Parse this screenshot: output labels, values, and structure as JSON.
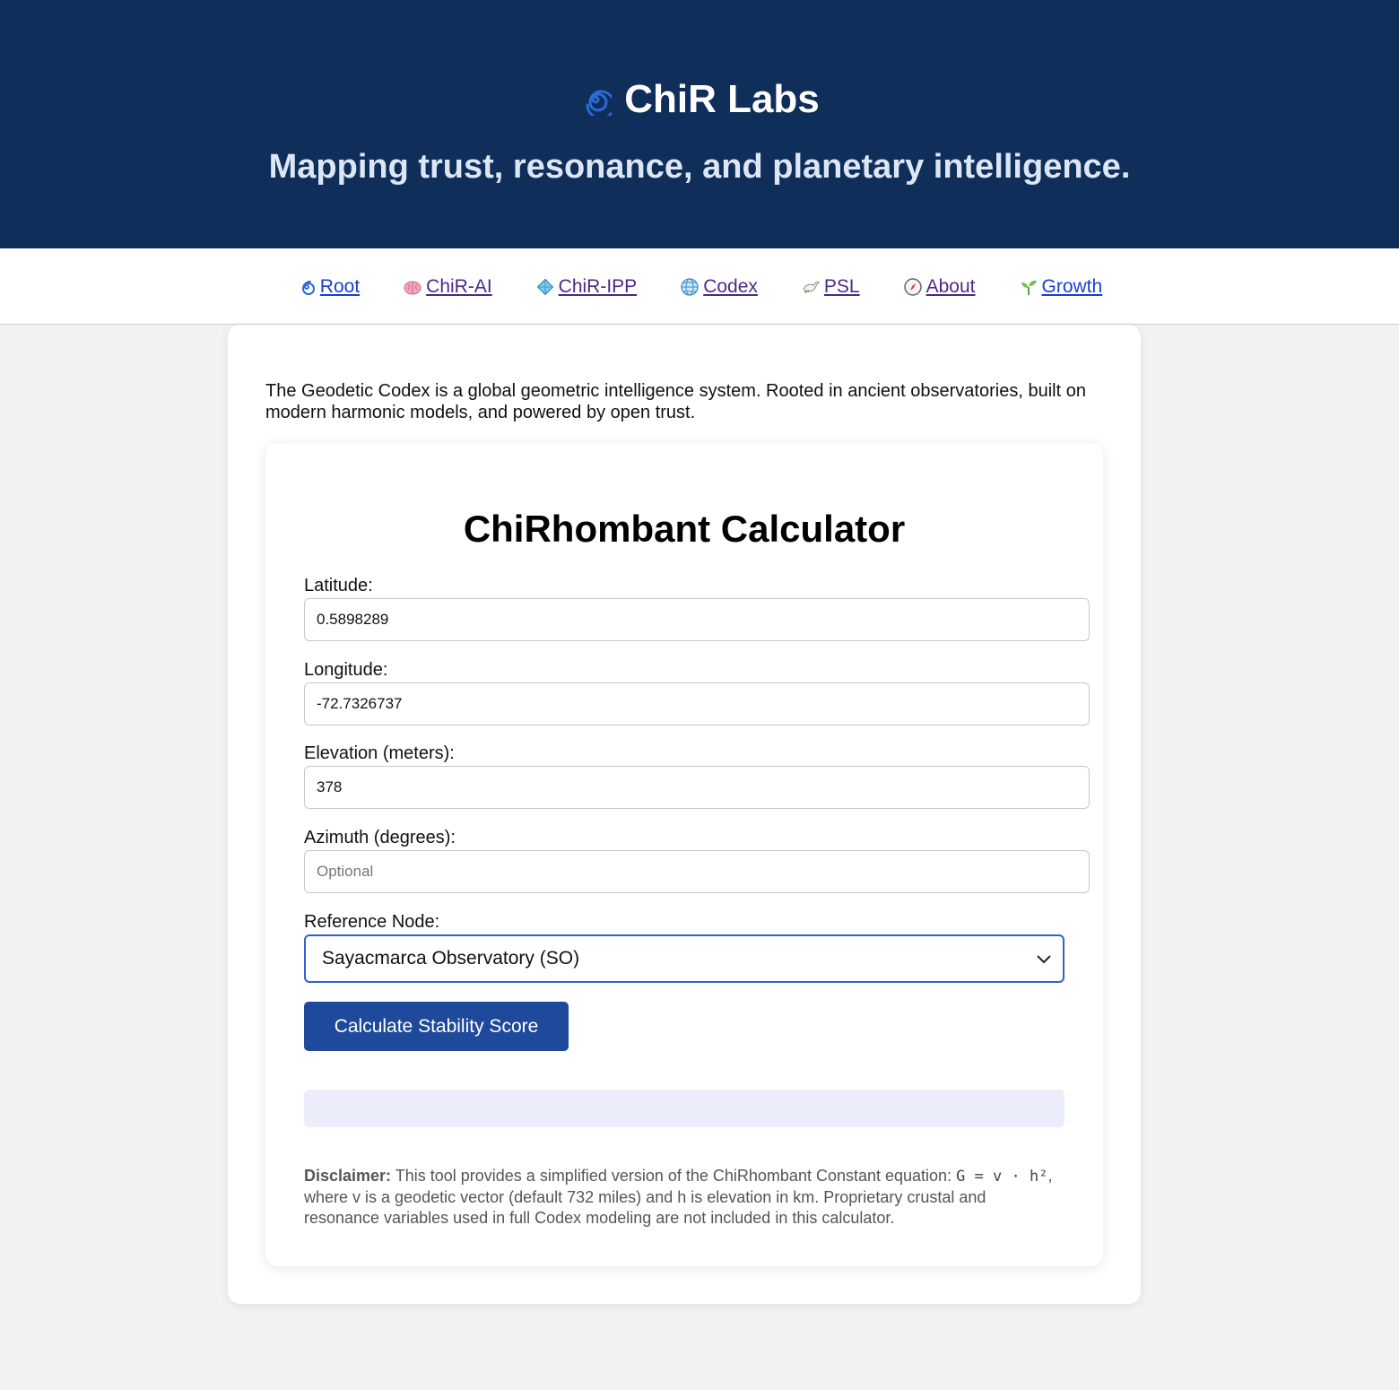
{
  "header": {
    "brand_title": "ChiR Labs",
    "brand_icon": "cyclone-icon",
    "tagline": "Mapping trust, resonance, and planetary intelligence."
  },
  "nav": {
    "items": [
      {
        "label": "Root",
        "icon": "cyclone-icon"
      },
      {
        "label": "ChiR-AI",
        "icon": "brain-icon"
      },
      {
        "label": "ChiR-IPP",
        "icon": "diamond-icon"
      },
      {
        "label": "Codex",
        "icon": "globe-icon"
      },
      {
        "label": "PSL",
        "icon": "dove-icon"
      },
      {
        "label": "About",
        "icon": "compass-icon"
      },
      {
        "label": "Growth",
        "icon": "seedling-icon"
      }
    ]
  },
  "main": {
    "intro": "The Geodetic Codex is a global geometric intelligence system. Rooted in ancient observatories, built on modern harmonic models, and powered by open trust."
  },
  "calculator": {
    "title": "ChiRhombant Calculator",
    "latitude_label": "Latitude:",
    "latitude_value": "0.5898289",
    "longitude_label": "Longitude:",
    "longitude_value": "-72.7326737",
    "elevation_label": "Elevation (meters):",
    "elevation_value": "378",
    "azimuth_label": "Azimuth (degrees):",
    "azimuth_value": "",
    "azimuth_placeholder": "Optional",
    "reference_label": "Reference Node:",
    "reference_value": "Sayacmarca Observatory (SO)",
    "button_label": "Calculate Stability Score",
    "result_text": "",
    "disclaimer_bold": "Disclaimer:",
    "disclaimer_pre": " This tool provides a simplified version of the ChiRhombant Constant equation: ",
    "disclaimer_equation": "G = v · h²",
    "disclaimer_post": ", where v is a geodetic vector (default 732 miles) and h is elevation in km. Proprietary crustal and resonance variables used in full Codex modeling are not included in this calculator."
  },
  "colors": {
    "header_bg": "#0f2e59",
    "button_bg": "#1f4a9c",
    "select_border": "#2f63c8",
    "result_bg": "#ecedfb"
  }
}
